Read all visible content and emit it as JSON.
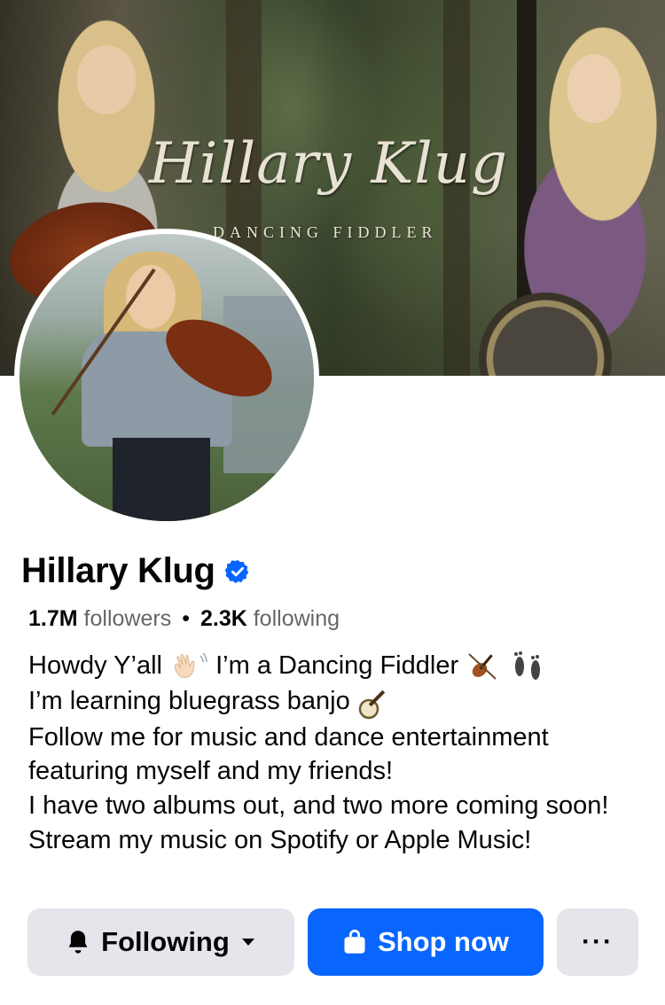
{
  "cover": {
    "title": "Hillary Klug",
    "subtitle": "DANCING FIDDLER"
  },
  "profile": {
    "name": "Hillary Klug",
    "verified": true,
    "followers_count": "1.7M",
    "followers_label": "followers",
    "following_count": "2.3K",
    "following_label": "following",
    "separator": "•"
  },
  "bio": {
    "line1_a": "Howdy Y’all",
    "line1_b": "I’m a Dancing Fiddler",
    "line2": "I’m learning bluegrass banjo",
    "line3": "Follow me for music and dance entertainment featuring myself and my friends!",
    "line4": "I have two albums out, and two more coming soon! Stream my music on Spotify or Apple Music!"
  },
  "actions": {
    "following_label": "Following",
    "shop_label": "Shop now",
    "more_label": "···"
  },
  "colors": {
    "primary": "#0866ff",
    "secondary_button": "#e4e6eb",
    "text": "#050505",
    "muted": "#65676b"
  },
  "icons": [
    "verified-badge-icon",
    "bell-icon",
    "caret-down-icon",
    "shopping-bag-icon",
    "more-icon",
    "waving-hand-icon",
    "violin-icon",
    "footprints-icon",
    "banjo-icon"
  ]
}
